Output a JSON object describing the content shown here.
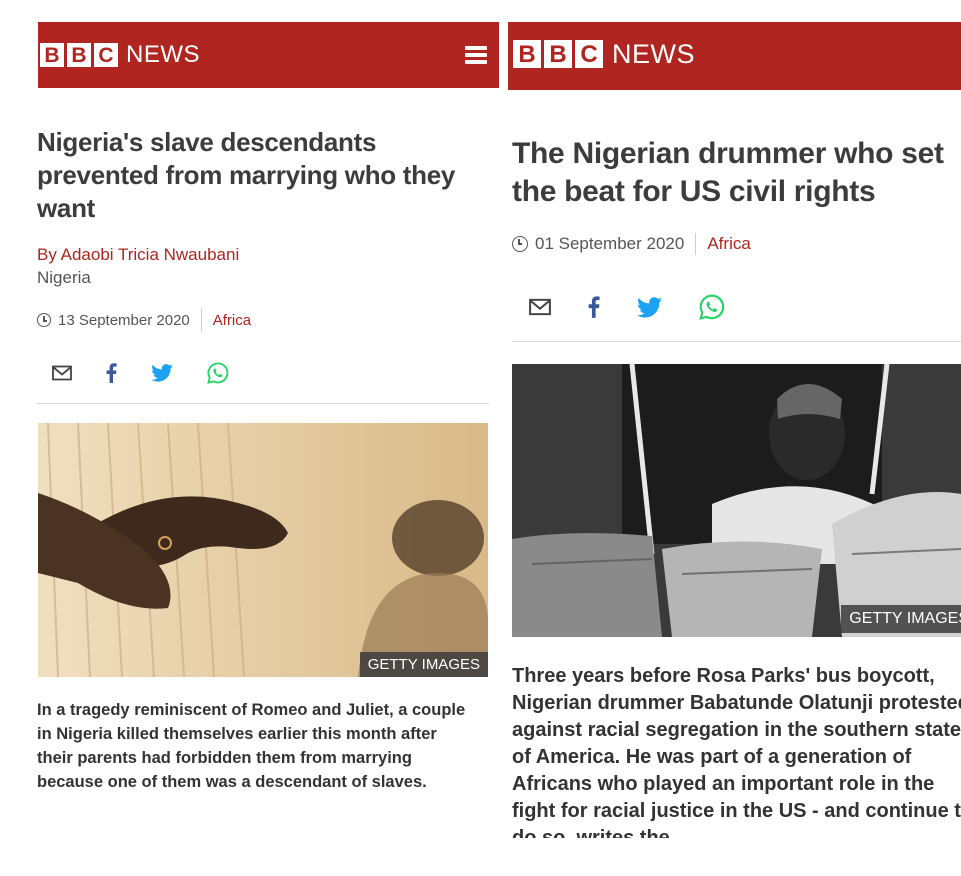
{
  "left_article": {
    "brand": {
      "letters": [
        "B",
        "B",
        "C"
      ],
      "news": "NEWS"
    },
    "headline": "Nigeria's slave descendants prevented from marrying who they want",
    "byline": "By Adaobi Tricia Nwaubani",
    "byline_location": "Nigeria",
    "date": "13 September 2020",
    "section": "Africa",
    "image_credit": "GETTY IMAGES",
    "lede": "In a tragedy reminiscent of Romeo and Juliet, a couple in Nigeria killed themselves earlier this month after their parents had forbidden them from marrying because one of them was a descendant of slaves."
  },
  "right_article": {
    "brand": {
      "letters": [
        "B",
        "B",
        "C"
      ],
      "news": "NEWS"
    },
    "headline": "The Nigerian drummer who set the beat for US civil rights",
    "date": "01 September 2020",
    "section": "Africa",
    "image_credit": "GETTY IMAGES",
    "lede": "Three years before Rosa Parks' bus boycott, Nigerian drummer Babatunde Olatunji protested against racial segregation in the southern states of America. He was part of a generation of Africans who played an important role in the fight for racial justice in the US - and continue to do so, writes the"
  },
  "colors": {
    "bbc_red": "#b0251f",
    "facebook_blue": "#3b5998",
    "twitter_blue": "#1da1f2",
    "whatsapp_green": "#25d366"
  },
  "icons": [
    "menu-icon",
    "clock-icon",
    "email-icon",
    "facebook-icon",
    "twitter-icon",
    "whatsapp-icon"
  ]
}
